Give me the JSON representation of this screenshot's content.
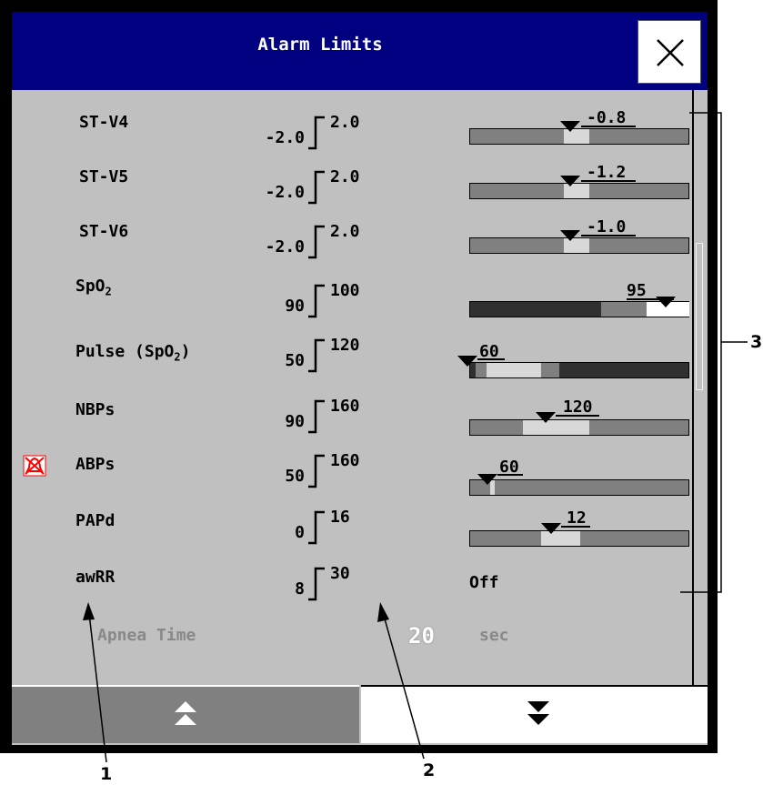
{
  "dialog": {
    "title": "Alarm Limits",
    "close_label": "×"
  },
  "rows": [
    {
      "label": "ST-V4",
      "low": "-2.0",
      "high": "2.0",
      "value": "-0.8"
    },
    {
      "label": "ST-V5",
      "low": "-2.0",
      "high": "2.0",
      "value": "-1.2"
    },
    {
      "label": "ST-V6",
      "low": "-2.0",
      "high": "2.0",
      "value": "-1.0"
    },
    {
      "label_main": "SpO",
      "label_sub": "2",
      "low": "90",
      "high": "100",
      "value": "95"
    },
    {
      "label_main": "Pulse (SpO",
      "label_sub": "2",
      "label_end": ")",
      "low": "50",
      "high": "120",
      "value": "60"
    },
    {
      "label": "NBPs",
      "low": "90",
      "high": "160",
      "value": "120"
    },
    {
      "label": "ABPs",
      "low": "50",
      "high": "160",
      "value": "60"
    },
    {
      "label": "PAPd",
      "low": "0",
      "high": "16",
      "value": "12"
    },
    {
      "label": "awRR",
      "low": "8",
      "high": "30",
      "value": "Off"
    }
  ],
  "apnea": {
    "label": "Apnea Time",
    "value": "20",
    "unit": "sec"
  },
  "callouts": {
    "c1": "1",
    "c2": "2",
    "c3": "3"
  },
  "colors": {
    "titlebar": "#010080",
    "panel": "#c0c0c0",
    "bar_dark": "#303030",
    "bar_mid": "#808080",
    "bar_light": "#d8d8d8"
  }
}
